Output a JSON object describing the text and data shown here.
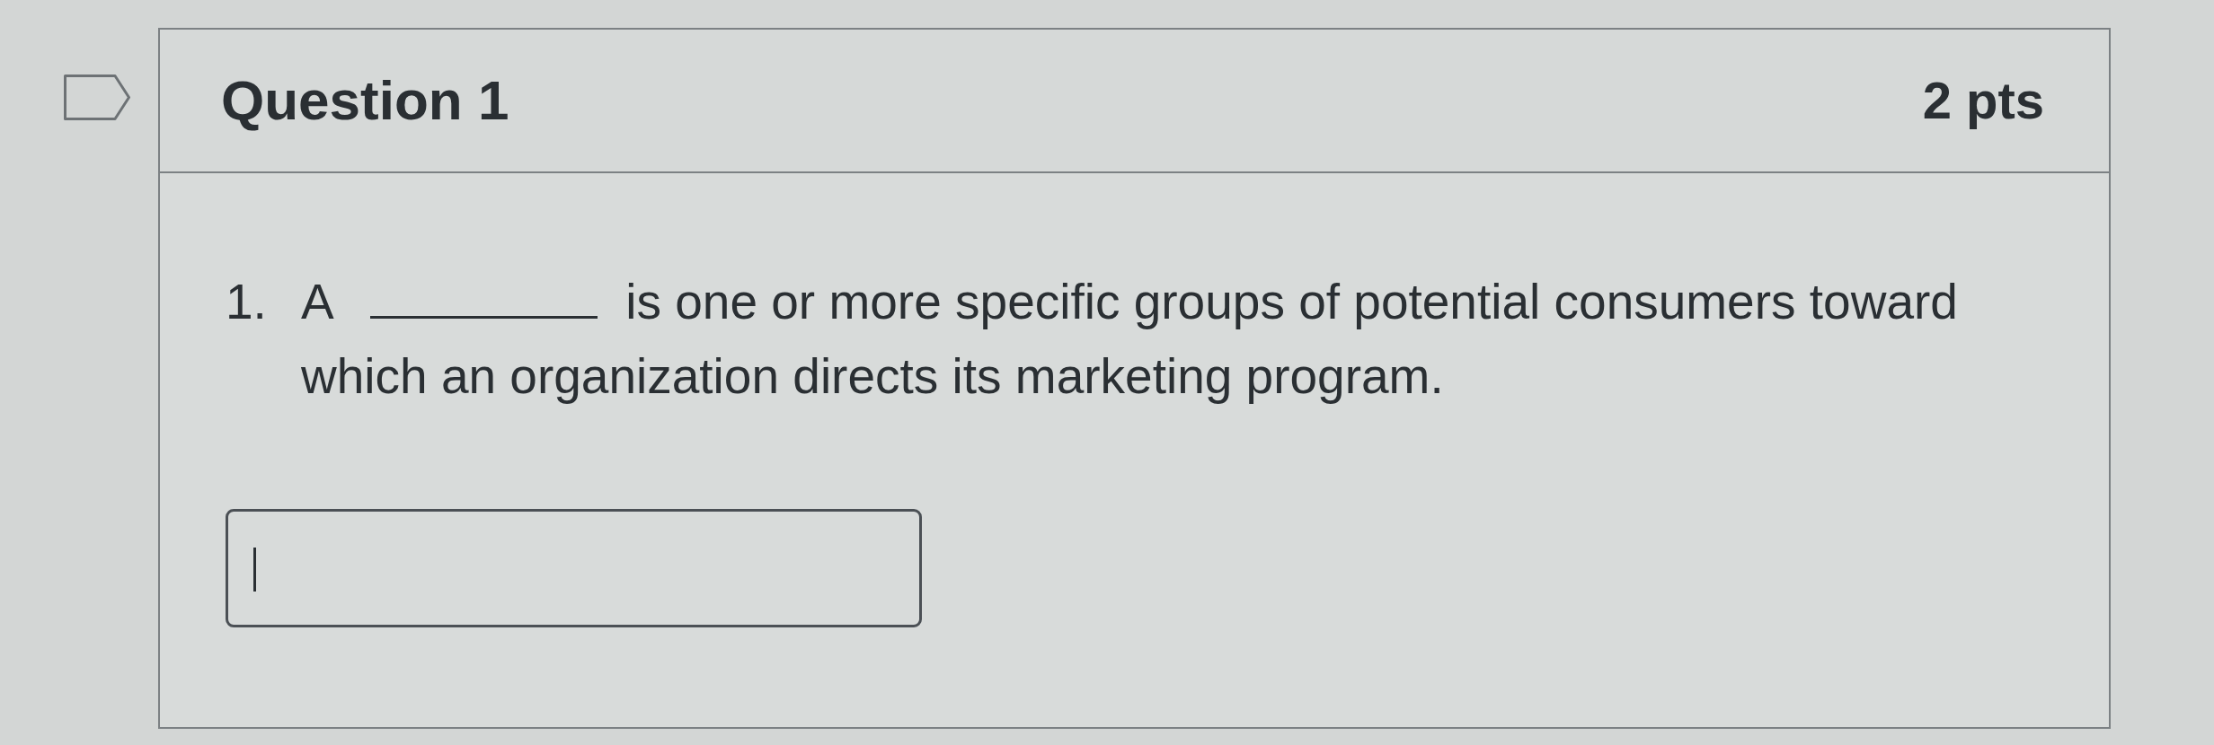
{
  "flag": {
    "flagged": false
  },
  "question": {
    "title": "Question 1",
    "points": "2 pts"
  },
  "item": {
    "number": "1.",
    "before": "A",
    "after": "is one or more specific groups of potential consumers toward which an organization directs its marketing program."
  },
  "answer_box": {
    "focused": true
  }
}
